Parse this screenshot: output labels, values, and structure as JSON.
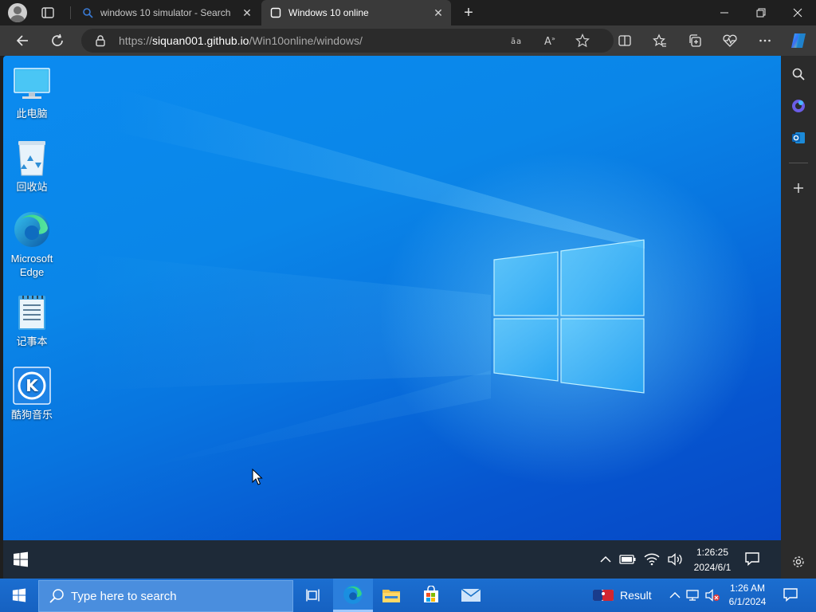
{
  "browser": {
    "tabs": [
      {
        "title": "windows 10 simulator - Search",
        "active": false,
        "favicon": "search-icon"
      },
      {
        "title": "Windows 10 online",
        "active": true,
        "favicon": "page-icon"
      }
    ],
    "url_prefix": "https://",
    "url_host": "siquan001.github.io",
    "url_path": "/Win10online/windows/",
    "accent": "#0078d4"
  },
  "simulator": {
    "desktop_icons": [
      {
        "label": "此电脑",
        "icon": "monitor-icon"
      },
      {
        "label": "回收站",
        "icon": "recycle-bin-icon"
      },
      {
        "label": "Microsoft Edge",
        "icon": "edge-icon"
      },
      {
        "label": "记事本",
        "icon": "notepad-icon"
      },
      {
        "label": "酷狗音乐",
        "icon": "kugou-icon"
      }
    ],
    "taskbar": {
      "time": "1:26:25",
      "date": "2024/6/1"
    }
  },
  "host_taskbar": {
    "search_placeholder": "Type here to search",
    "weather_label": "Result",
    "time": "1:26 AM",
    "date": "6/1/2024"
  }
}
